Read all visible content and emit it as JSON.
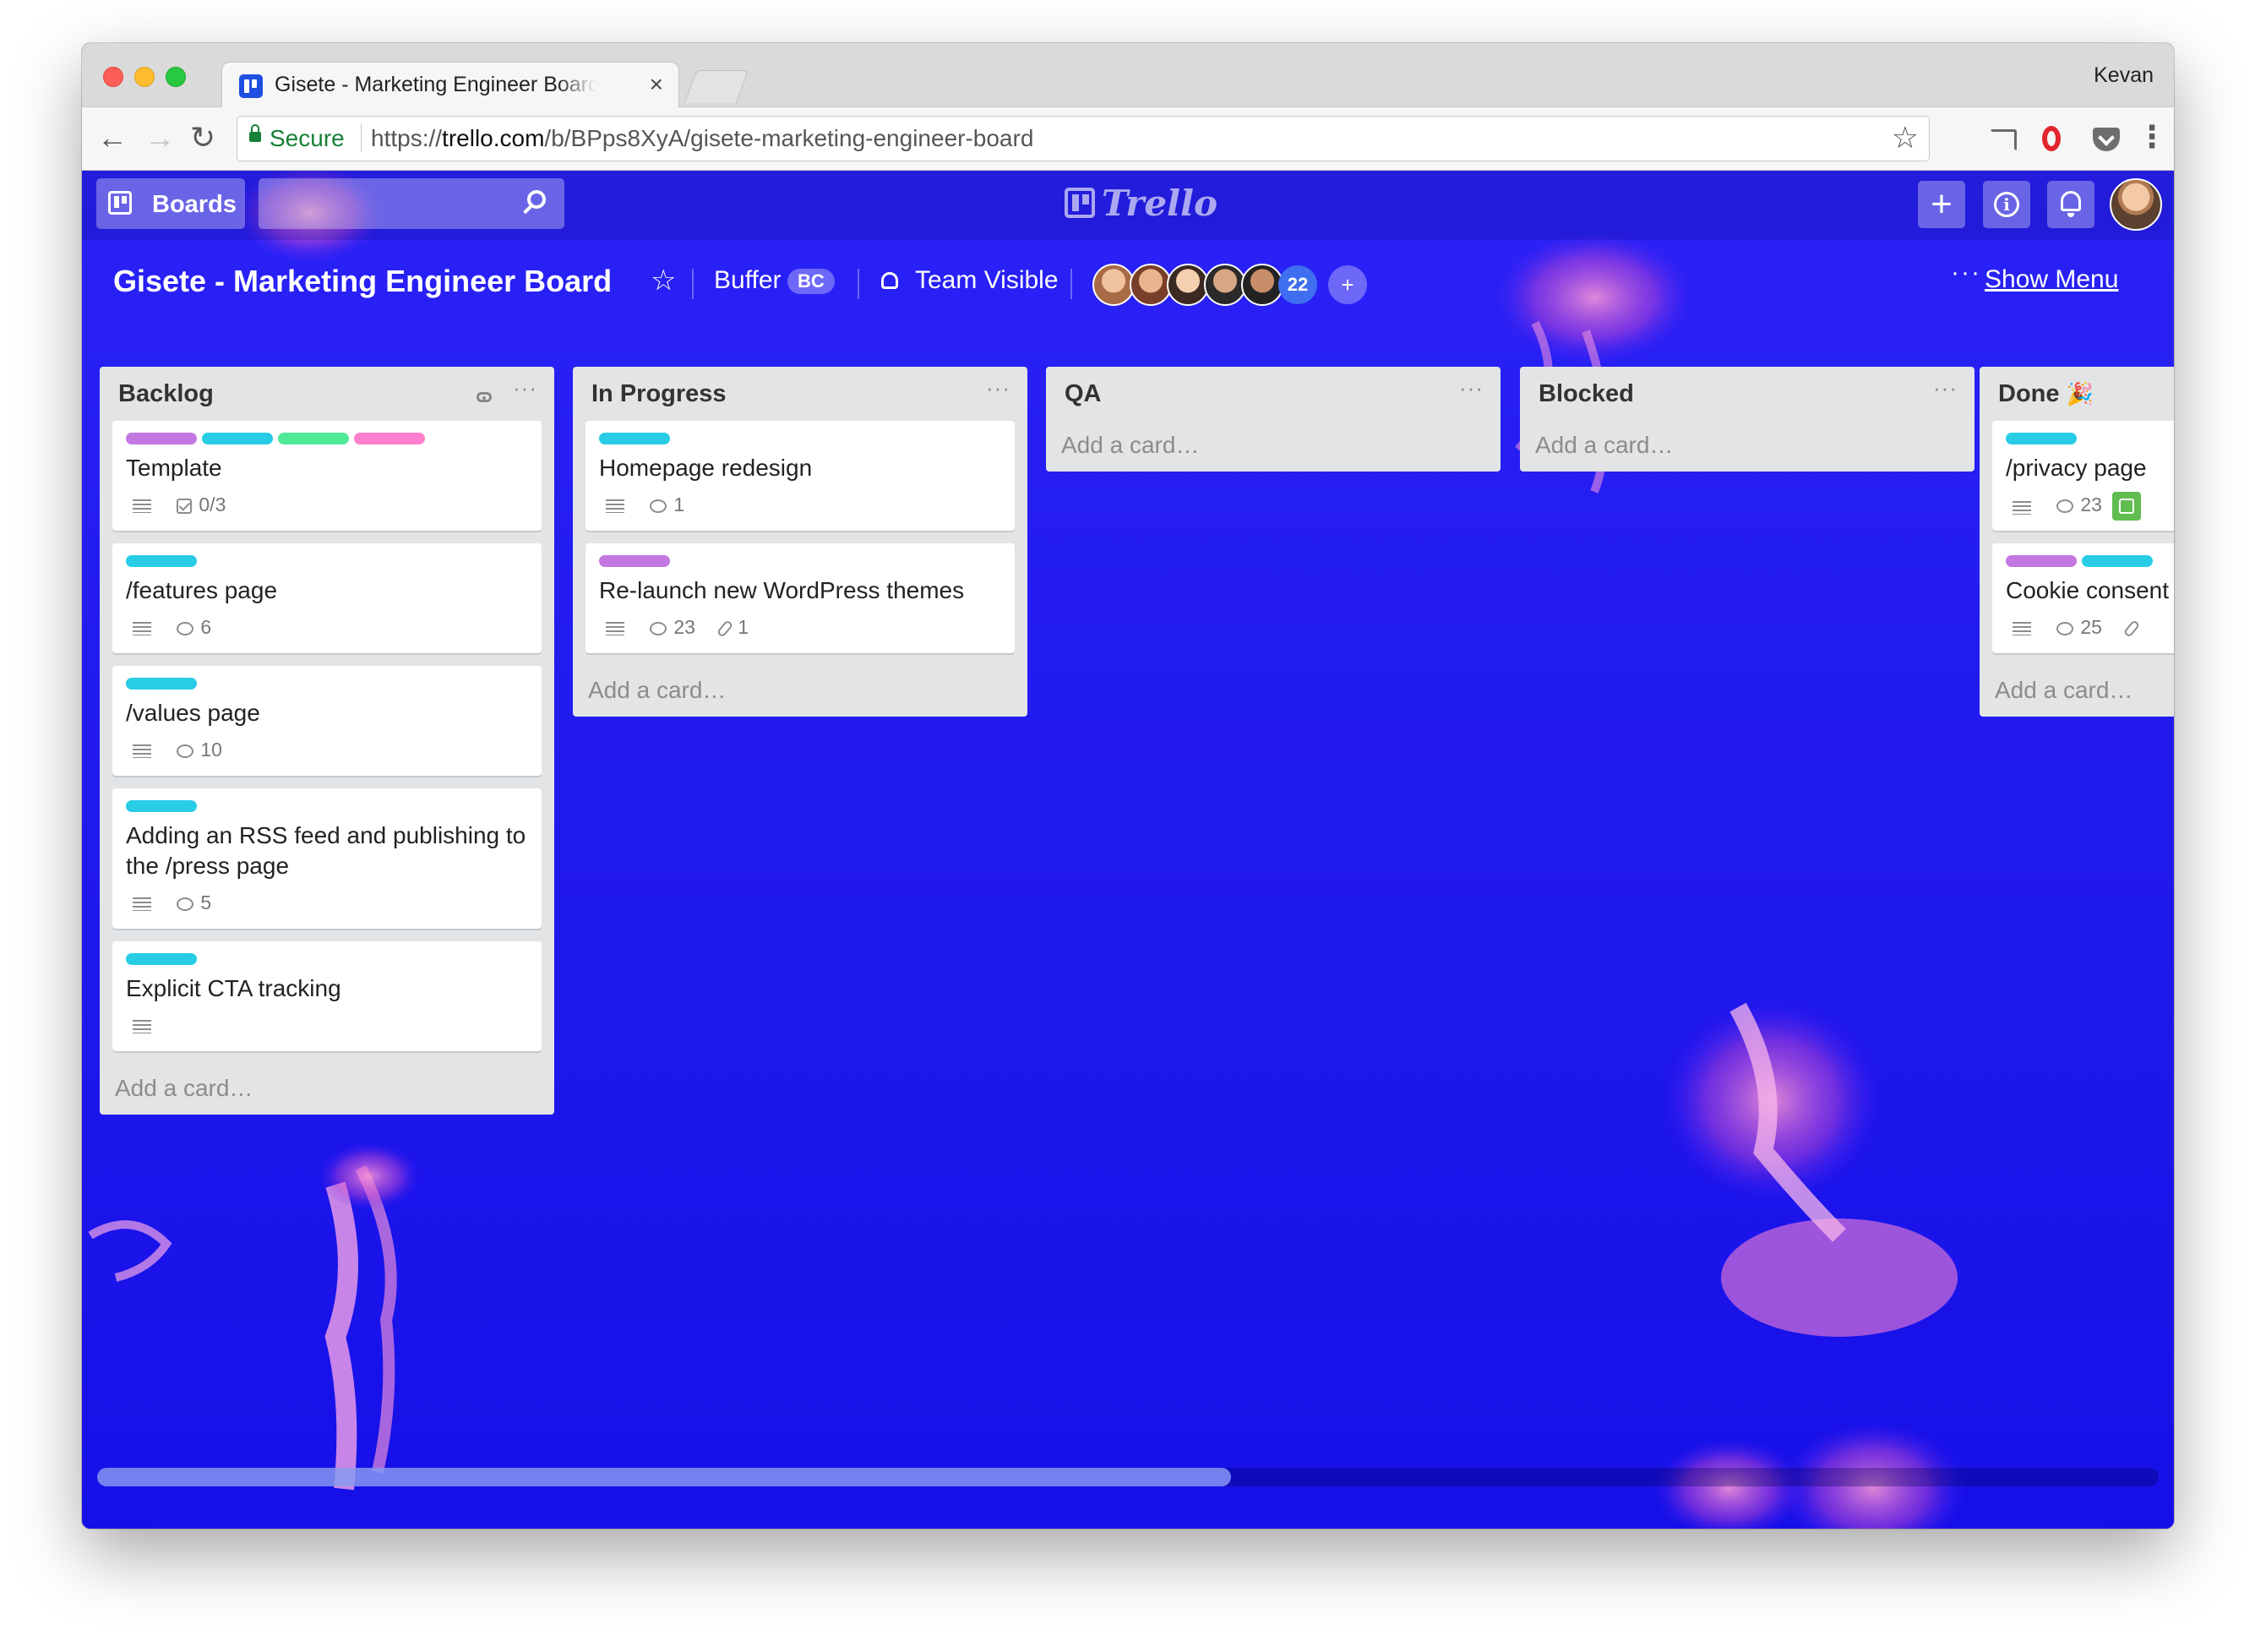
{
  "browser": {
    "tab_title": "Gisete - Marketing Engineer Board",
    "tab_close": "×",
    "profile_name": "Kevan",
    "secure_label": "Secure",
    "url_scheme": "https://",
    "url_host": "trello.com",
    "url_path": "/b/BPps8XyA/gisete-marketing-engineer-board",
    "back": "←",
    "forward": "→",
    "reload": "↻",
    "star": "☆",
    "menu": "⋮"
  },
  "header": {
    "boards_label": "Boards",
    "logo_text": "Trello",
    "add_label": "+",
    "info_label": "i"
  },
  "board": {
    "title": "Gisete - Marketing Engineer Board",
    "star": "☆",
    "team_name": "Buffer",
    "team_badge": "BC",
    "visibility": "Team Visible",
    "member_count": "22",
    "add_member": "+",
    "show_menu_dots": "···",
    "show_menu": "Show Menu"
  },
  "colors": {
    "purple": "#c377e0",
    "sky": "#29cce5",
    "green": "#51e898",
    "pink": "#ff80ce",
    "board_bg": "#1c17f2"
  },
  "lists": [
    {
      "title": "Backlog",
      "watched": true,
      "menu": "···",
      "add_card": "Add a card…",
      "cards": [
        {
          "labels": [
            "purple",
            "sky",
            "green",
            "pink"
          ],
          "title": "Template",
          "desc": true,
          "checklist": "0/3"
        },
        {
          "labels": [
            "sky"
          ],
          "title": "/features page",
          "desc": true,
          "comments": "6"
        },
        {
          "labels": [
            "sky"
          ],
          "title": "/values page",
          "desc": true,
          "comments": "10"
        },
        {
          "labels": [
            "sky"
          ],
          "title": "Adding an RSS feed and publishing to the /press page",
          "desc": true,
          "comments": "5"
        },
        {
          "labels": [
            "sky"
          ],
          "title": "Explicit CTA tracking",
          "desc": true
        }
      ]
    },
    {
      "title": "In Progress",
      "menu": "···",
      "add_card": "Add a card…",
      "cards": [
        {
          "labels": [
            "sky"
          ],
          "title": "Homepage redesign",
          "desc": true,
          "comments": "1"
        },
        {
          "labels": [
            "purple"
          ],
          "title": "Re-launch new WordPress themes",
          "desc": true,
          "comments": "23",
          "attachments": "1"
        }
      ]
    },
    {
      "title": "QA",
      "menu": "···",
      "add_card": "Add a card…",
      "cards": []
    },
    {
      "title": "Blocked",
      "menu": "···",
      "add_card": "Add a card…",
      "cards": []
    },
    {
      "title": "Done",
      "title_icon": "🎉",
      "menu": "···",
      "add_card": "Add a card…",
      "cards": [
        {
          "labels": [
            "sky"
          ],
          "title": "/privacy page",
          "desc": true,
          "comments": "23",
          "done_badge": true
        },
        {
          "labels": [
            "purple",
            "sky"
          ],
          "title": "Cookie consent",
          "desc": true,
          "comments": "25",
          "attachments": ""
        }
      ]
    }
  ],
  "scroll": {
    "position_fraction": 0.0,
    "visible_fraction": 0.55
  }
}
